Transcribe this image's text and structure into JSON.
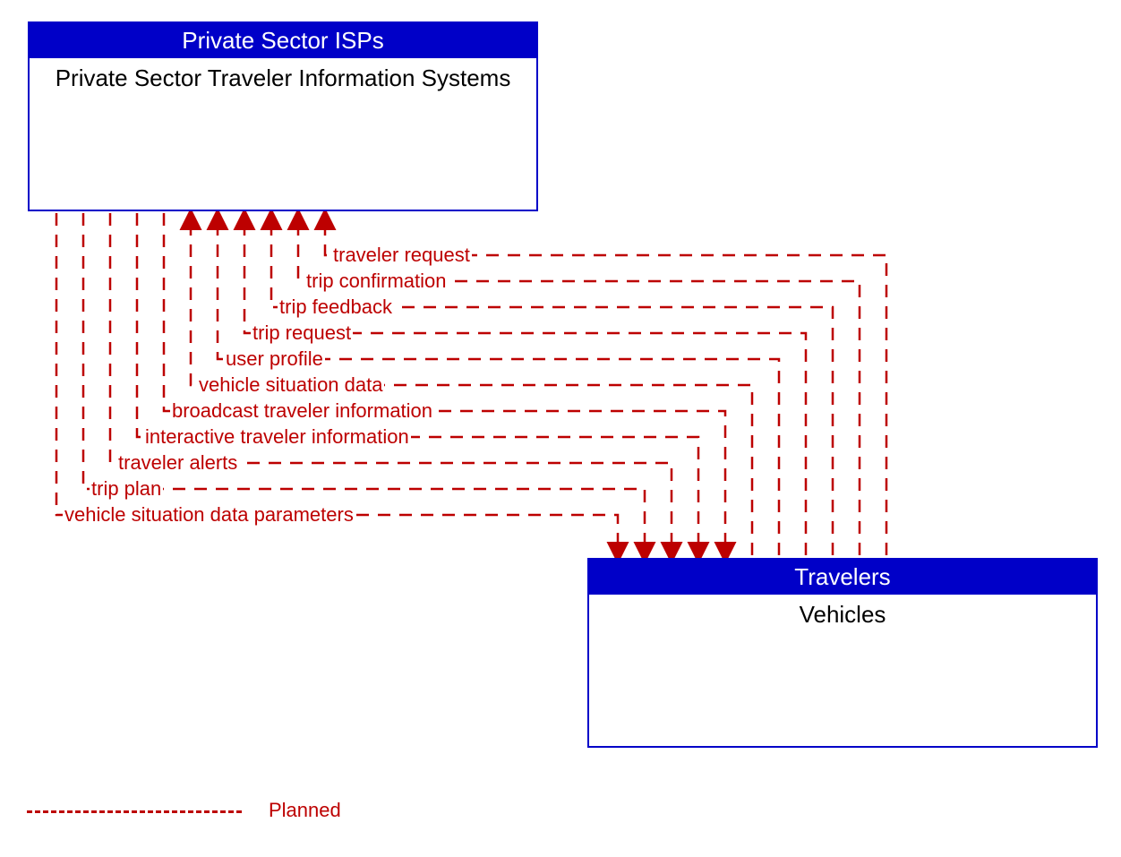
{
  "boxes": {
    "isp": {
      "header": "Private Sector ISPs",
      "title": "Private Sector Traveler Information Systems"
    },
    "travelers": {
      "header": "Travelers",
      "title": "Vehicles"
    }
  },
  "flows_to_travelers": [
    "vehicle situation data parameters",
    "trip plan",
    "traveler alerts",
    "interactive traveler information",
    "broadcast traveler information"
  ],
  "flows_to_isp": [
    "vehicle situation data",
    "user profile",
    "trip request",
    "trip feedback",
    "trip confirmation",
    "traveler request"
  ],
  "legend": {
    "label": "Planned"
  },
  "colors": {
    "blue": "#0000c8",
    "red": "#bd0000"
  }
}
